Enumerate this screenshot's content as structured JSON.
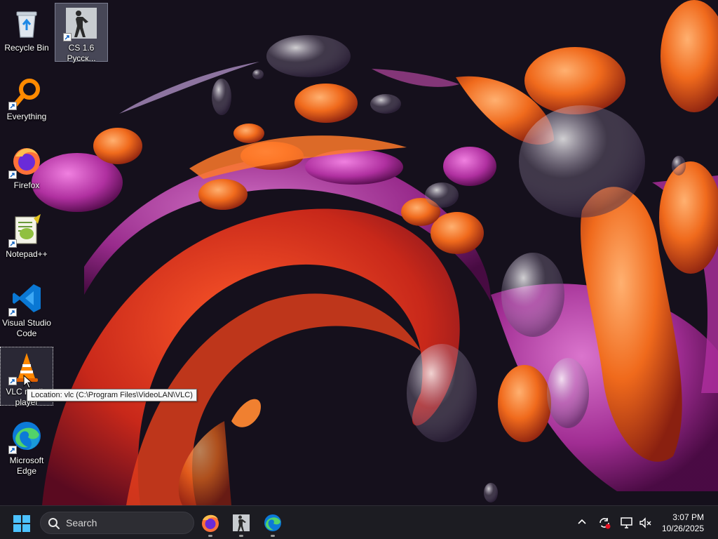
{
  "desktop": {
    "icons": [
      {
        "label": "Recycle Bin"
      },
      {
        "label": "CS 1.6 Русск..."
      },
      {
        "label": "Everything"
      },
      {
        "label": "Firefox"
      },
      {
        "label": "Notepad++"
      },
      {
        "label": "Visual Studio Code"
      },
      {
        "label": "VLC media player"
      },
      {
        "label": "Microsoft Edge"
      }
    ],
    "tooltip": "Location: vlc (C:\\Program Files\\VideoLAN\\VLC)"
  },
  "taskbar": {
    "search_placeholder": "Search",
    "pinned": [
      "firefox-icon",
      "cs-icon",
      "edge-icon"
    ],
    "tray": [
      "chevron-up-icon",
      "sync-icon",
      "display-icon",
      "volume-mute-icon"
    ],
    "time": "3:07 PM",
    "date": "10/26/2025"
  }
}
